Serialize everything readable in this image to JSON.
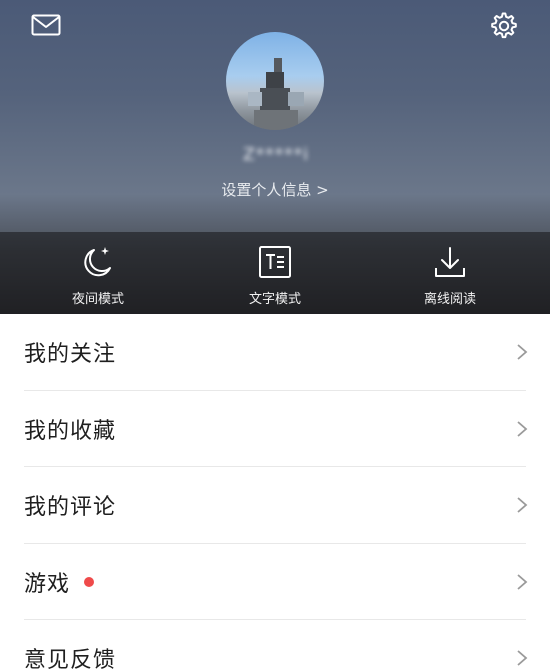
{
  "header": {
    "username": "Z*****i",
    "profile_link": "设置个人信息 >"
  },
  "modes": [
    {
      "label": "夜间模式",
      "icon": "moon-icon"
    },
    {
      "label": "文字模式",
      "icon": "text-mode-icon"
    },
    {
      "label": "离线阅读",
      "icon": "download-icon"
    }
  ],
  "menu": [
    {
      "label": "我的关注"
    },
    {
      "label": "我的收藏"
    },
    {
      "label": "我的评论"
    },
    {
      "label": "游戏",
      "badge_color": "#ef4a4a"
    },
    {
      "label": "意见反馈"
    }
  ],
  "colors": {
    "accent_dot": "#ef4a4a"
  }
}
